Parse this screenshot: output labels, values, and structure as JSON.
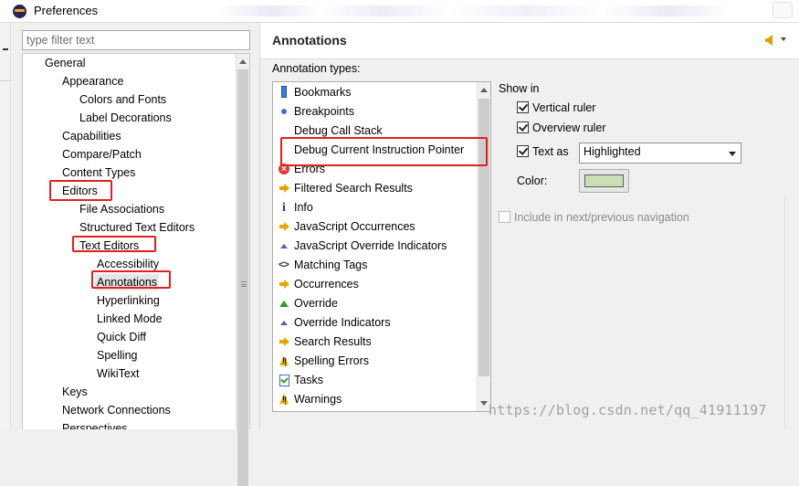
{
  "window": {
    "title": "Preferences"
  },
  "filter": {
    "placeholder": "type filter text"
  },
  "tree": {
    "items": [
      "General",
      "Appearance",
      "Colors and Fonts",
      "Label Decorations",
      "Capabilities",
      "Compare/Patch",
      "Content Types",
      "Editors",
      "File Associations",
      "Structured Text Editors",
      "Text Editors",
      "Accessibility",
      "Annotations",
      "Hyperlinking",
      "Linked Mode",
      "Quick Diff",
      "Spelling",
      "WikiText",
      "Keys",
      "Network Connections",
      "Perspectives"
    ],
    "selected": "Annotations"
  },
  "page": {
    "title": "Annotations",
    "types_label": "Annotation types:"
  },
  "annotation_types": [
    {
      "label": "Bookmarks",
      "icon": "bookmark-icon"
    },
    {
      "label": "Breakpoints",
      "icon": "breakpoint-icon"
    },
    {
      "label": "Debug Call Stack",
      "icon": ""
    },
    {
      "label": "Debug Current Instruction Pointer",
      "icon": ""
    },
    {
      "label": "Errors",
      "icon": "error-icon"
    },
    {
      "label": "Filtered Search Results",
      "icon": "arrow-icon"
    },
    {
      "label": "Info",
      "icon": "info-icon"
    },
    {
      "label": "JavaScript Occurrences",
      "icon": "arrow-icon"
    },
    {
      "label": "JavaScript Override Indicators",
      "icon": "triangle-up-icon"
    },
    {
      "label": "Matching Tags",
      "icon": "brackets-icon"
    },
    {
      "label": "Occurrences",
      "icon": "arrow-icon"
    },
    {
      "label": "Override",
      "icon": "green-triangle-icon"
    },
    {
      "label": "Override Indicators",
      "icon": "triangle-up-icon"
    },
    {
      "label": "Search Results",
      "icon": "arrow-icon"
    },
    {
      "label": "Spelling Errors",
      "icon": "warning-icon"
    },
    {
      "label": "Tasks",
      "icon": "task-icon"
    },
    {
      "label": "Warnings",
      "icon": "warning-icon"
    }
  ],
  "selected_annotation": "Debug Current Instruction Pointer",
  "show_in": {
    "label": "Show in",
    "vertical_ruler": {
      "label": "Vertical ruler",
      "checked": true
    },
    "overview_ruler": {
      "label": "Overview ruler",
      "checked": true
    },
    "text_as": {
      "label": "Text as",
      "checked": true,
      "value": "Highlighted"
    },
    "color_label": "Color:",
    "color_value": "#c8e0b4",
    "navigation": {
      "label": "Include in next/previous navigation",
      "checked": false,
      "enabled": false
    }
  },
  "watermark": "https://blog.csdn.net/qq_41911197"
}
